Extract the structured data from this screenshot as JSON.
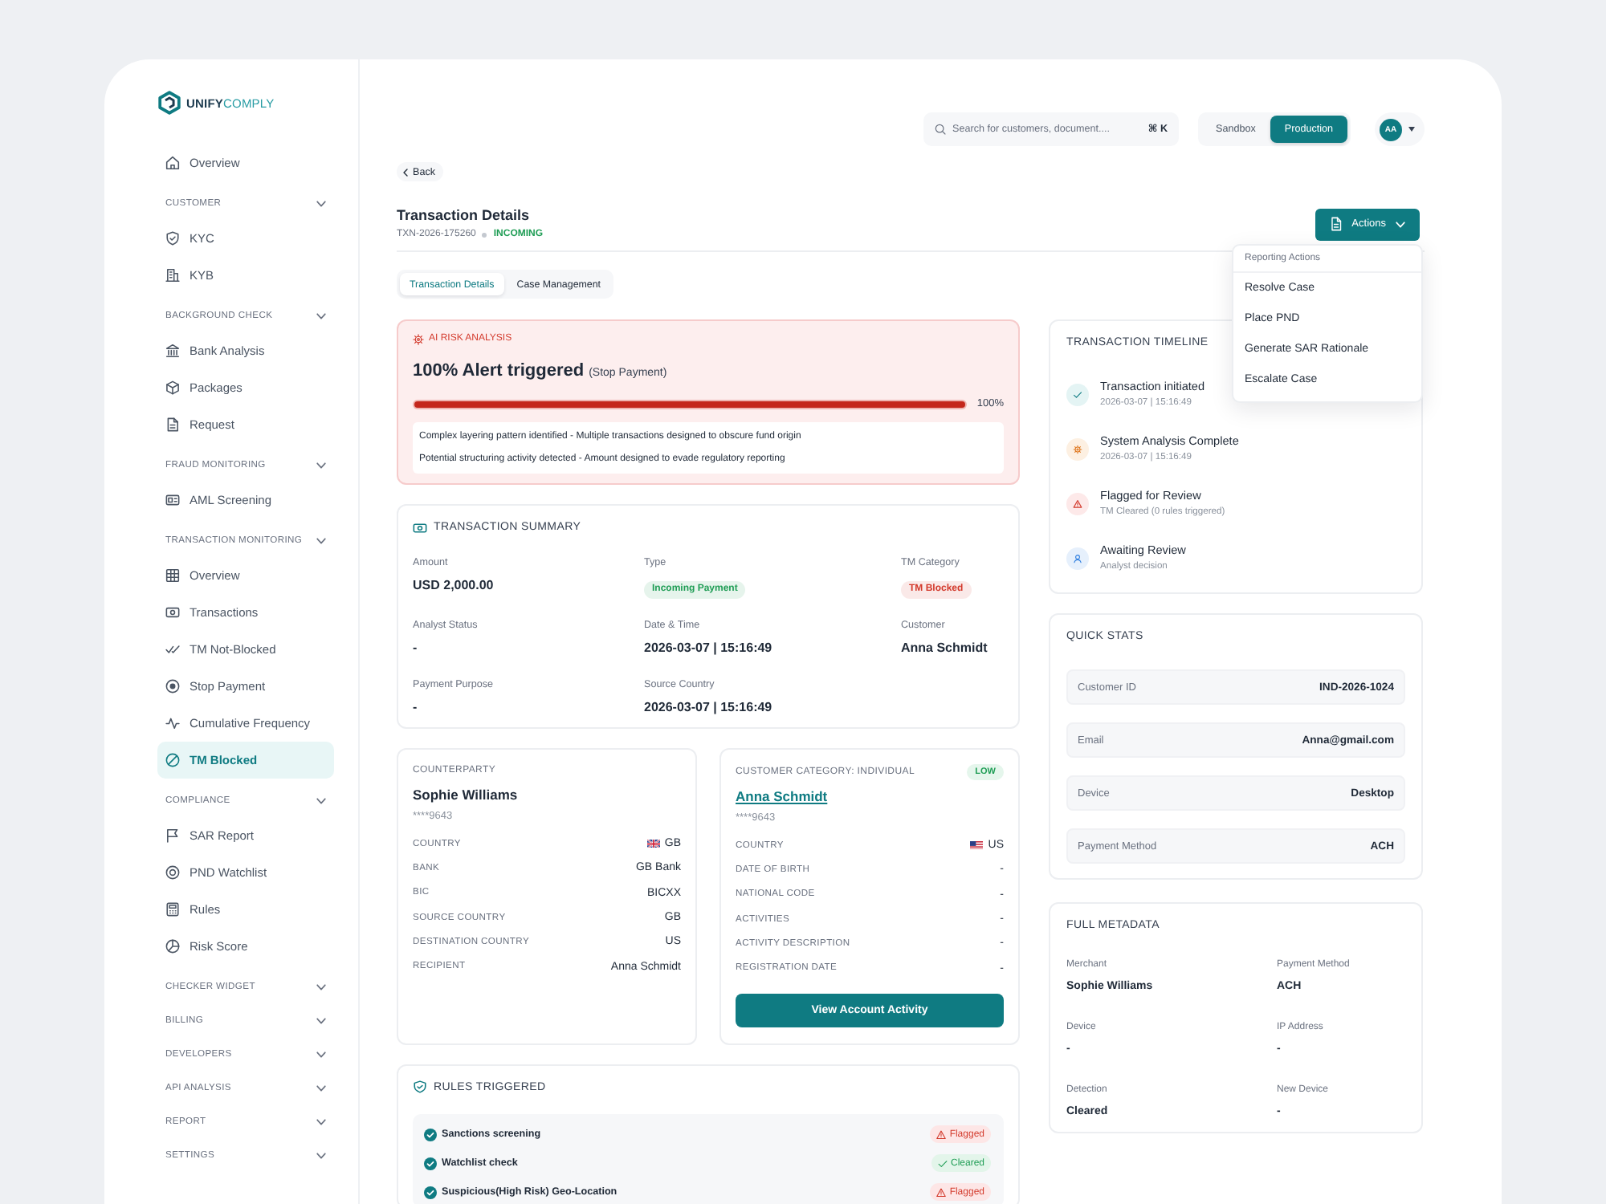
{
  "sidebar": {
    "logo": "**UNIFY**COMPLY",
    "nav": [
      {
        "kind": "link",
        "label": "Overview",
        "selected": false
      },
      {
        "kind": "section",
        "label": "CUSTOMER",
        "children": [
          {
            "label": "KYC",
            "selected": false
          },
          {
            "label": "KYB",
            "selected": false
          }
        ]
      },
      {
        "kind": "section",
        "label": "BACKGROUND CHECK",
        "children": [
          {
            "label": "Bank Analysis",
            "selected": false
          },
          {
            "label": "Packages",
            "selected": false
          },
          {
            "label": "Request",
            "selected": false
          }
        ]
      },
      {
        "kind": "section",
        "label": "FRAUD MONITORING",
        "children": [
          {
            "label": "AML Screening",
            "selected": false
          }
        ]
      },
      {
        "kind": "section",
        "label": "TRANSACTION MONITORING",
        "children": [
          {
            "label": "Overview",
            "selected": false
          },
          {
            "label": "Transactions",
            "selected": false
          },
          {
            "label": "TM Not-Blocked",
            "selected": false
          },
          {
            "label": "Stop Payment",
            "selected": false
          },
          {
            "label": "Cumulative Frequency",
            "selected": false
          },
          {
            "label": "TM Blocked",
            "selected": true
          }
        ]
      },
      {
        "kind": "section",
        "label": "COMPLIANCE",
        "children": [
          {
            "label": "SAR Report",
            "selected": false
          },
          {
            "label": "PND Watchlist",
            "selected": false
          },
          {
            "label": "Rules",
            "selected": false
          },
          {
            "label": "Risk Score",
            "selected": false
          }
        ]
      },
      {
        "kind": "section",
        "label": "CHECKER WIDGET"
      },
      {
        "kind": "section",
        "label": "BILLING"
      },
      {
        "kind": "section",
        "label": "DEVELOPERS"
      },
      {
        "kind": "section",
        "label": "API ANALYSIS"
      },
      {
        "kind": "section",
        "label": "REPORT"
      },
      {
        "kind": "section",
        "label": "SETTINGS"
      }
    ]
  },
  "header": {
    "search": {
      "placeholder": "Search for customers, document....",
      "shortcut": "⌘ K"
    },
    "environment": [
      {
        "label": "Sandbox",
        "selected": false
      },
      {
        "label": "Production",
        "selected": true
      }
    ],
    "avatar": "AA"
  },
  "back": "Back",
  "page": {
    "title": "Transaction Details",
    "reference": "TXN-2026-175260",
    "direction": "INCOMING",
    "actions": "Actions"
  },
  "actions_menu": {
    "heading": "Reporting Actions",
    "items": [
      "Resolve Case",
      "Place PND",
      "Generate SAR Rationale",
      "Escalate Case"
    ]
  },
  "tabs": [
    {
      "label": "Transaction Details",
      "selected": true
    },
    {
      "label": "Case Management",
      "selected": false
    }
  ],
  "ai_risk": {
    "heading": "AI RISK ANALYSIS",
    "title": "100% Alert triggered",
    "qualifier": "(Stop Payment)",
    "level": 1,
    "reading": "100%",
    "findings": [
      "Complex layering pattern identified - Multiple transactions designed to obscure fund origin",
      "Potential structuring activity detected - Amount designed to evade regulatory reporting"
    ]
  },
  "summary": {
    "heading": "TRANSACTION SUMMARY",
    "fields": [
      {
        "kind": "text",
        "label": "Amount",
        "value": "USD 2,000.00"
      },
      {
        "kind": "badge",
        "label": "Type",
        "value": "Incoming Payment",
        "color": "#1f9d55"
      },
      {
        "kind": "badge",
        "label": "TM Category",
        "value": "TM Blocked",
        "color": "#d33a2c"
      },
      {
        "kind": "text",
        "label": "Analyst Status",
        "value": "-"
      },
      {
        "kind": "text",
        "label": "Date & Time",
        "value": "2026-03-07 | 15:16:49"
      },
      {
        "kind": "text",
        "label": "Customer",
        "value": "Anna Schmidt"
      },
      {
        "kind": "text",
        "label": "Payment Purpose",
        "value": "-"
      },
      {
        "kind": "text",
        "label": "Source Country",
        "value": "2026-03-07 | 15:16:49"
      }
    ]
  },
  "counterparty": {
    "heading": "COUNTERPARTY",
    "name": "Sophie Williams",
    "account": "****9643",
    "rows": [
      {
        "kind": "country",
        "label": "COUNTRY",
        "value": "GB"
      },
      {
        "kind": "text",
        "label": "BANK",
        "value": "GB Bank"
      },
      {
        "kind": "text",
        "label": "BIC",
        "value": "BICXX"
      },
      {
        "kind": "text",
        "label": "SOURCE COUNTRY",
        "value": "GB"
      },
      {
        "kind": "text",
        "label": "DESTINATION COUNTRY",
        "value": "US"
      },
      {
        "kind": "text",
        "label": "RECIPIENT",
        "value": "Anna Schmidt"
      }
    ]
  },
  "customer": {
    "category": "CUSTOMER CATEGORY: INDIVIDUAL",
    "risk": "LOW",
    "name": "Anna Schmidt",
    "account": "****9643",
    "rows": [
      {
        "kind": "country",
        "label": "COUNTRY",
        "value": "US"
      },
      {
        "kind": "text",
        "label": "DATE OF BIRTH",
        "value": "-"
      },
      {
        "kind": "text",
        "label": "NATIONAL CODE",
        "value": "-"
      },
      {
        "kind": "text",
        "label": "ACTIVITIES",
        "value": "-"
      },
      {
        "kind": "text",
        "label": "ACTIVITY DESCRIPTION",
        "value": "-"
      },
      {
        "kind": "text",
        "label": "REGISTRATION DATE",
        "value": "-"
      }
    ],
    "button": "View Account Activity"
  },
  "rules": {
    "heading": "RULES TRIGGERED",
    "items": [
      {
        "name": "Sanctions screening",
        "kind": "flagged",
        "status": "Flagged"
      },
      {
        "name": "Watchlist check",
        "kind": "cleared",
        "status": "Cleared"
      },
      {
        "name": "Suspicious(High Risk) Geo-Location",
        "kind": "flagged",
        "status": "Flagged"
      }
    ]
  },
  "timeline": {
    "heading": "TRANSACTION TIMELINE",
    "events": [
      {
        "kind": "done",
        "title": "Transaction initiated",
        "detail": "2026-03-07 | 15:16:49"
      },
      {
        "kind": "analysis",
        "title": "System Analysis Complete",
        "detail": "2026-03-07 | 15:16:49"
      },
      {
        "kind": "flagged",
        "title": "Flagged for Review",
        "detail": "TM Cleared (0 rules triggered)"
      },
      {
        "kind": "pending",
        "title": "Awaiting Review",
        "detail": "Analyst decision"
      }
    ]
  },
  "quick_stats": {
    "heading": "QUICK STATS",
    "rows": [
      {
        "label": "Customer ID",
        "value": "IND-2026-1024"
      },
      {
        "label": "Email",
        "value": "Anna@gmail.com"
      },
      {
        "label": "Device",
        "value": "Desktop"
      },
      {
        "label": "Payment Method",
        "value": "ACH"
      }
    ]
  },
  "metadata": {
    "heading": "FULL METADATA",
    "fields": [
      {
        "label": "Merchant",
        "value": "Sophie Williams"
      },
      {
        "label": "Payment Method",
        "value": "ACH"
      },
      {
        "label": "Device",
        "value": "-"
      },
      {
        "label": "IP Address",
        "value": "-"
      },
      {
        "label": "Detection",
        "value": "Cleared"
      },
      {
        "label": "New Device",
        "value": "-"
      }
    ]
  }
}
